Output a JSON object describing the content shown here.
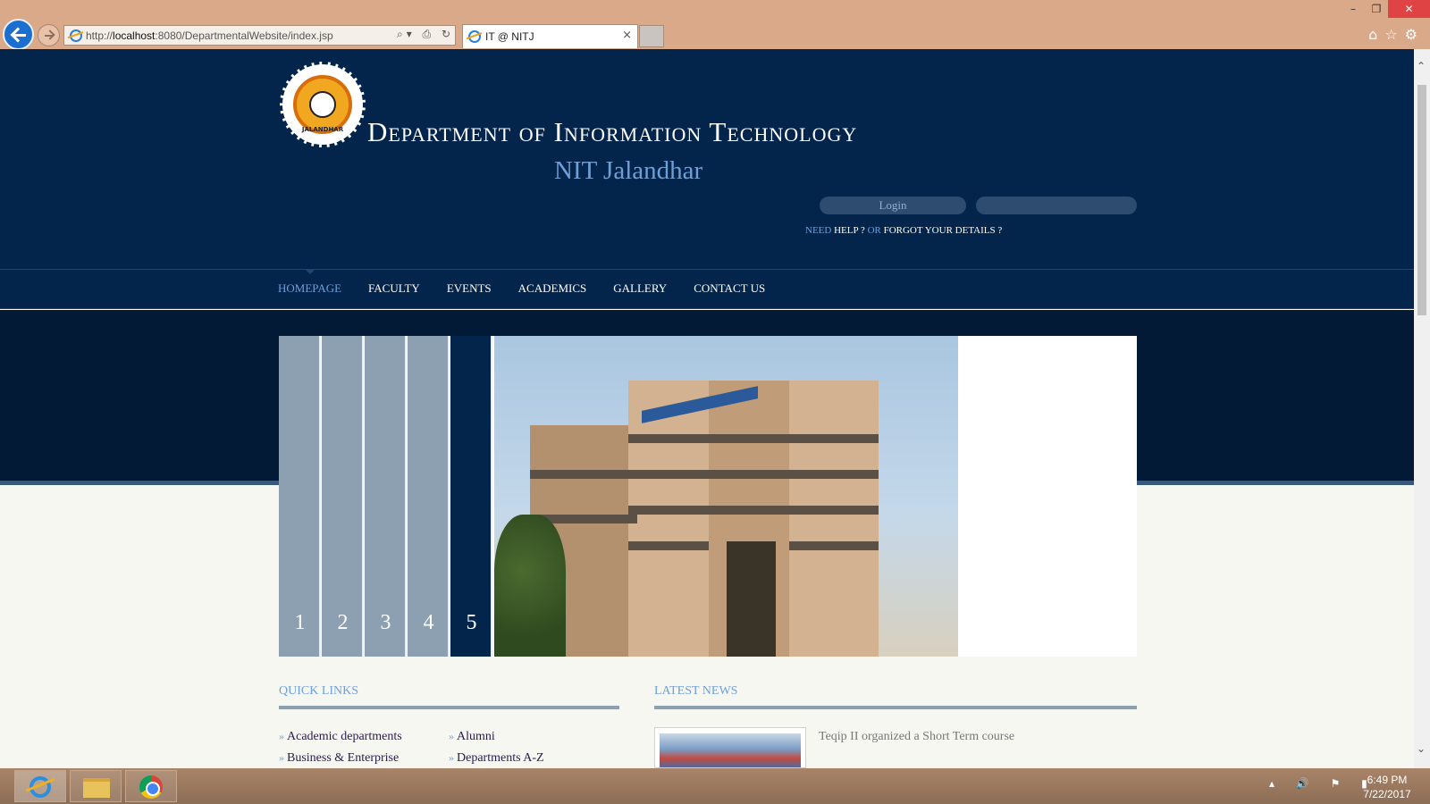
{
  "browser": {
    "url_prefix": "http://",
    "url_host": "localhost",
    "url_rest": ":8080/DepartmentalWebsite/index.jsp",
    "tab_title": "IT @ NITJ",
    "tab_close": "×",
    "addr_tools": "⌕▾ ⎙ ↻",
    "win_minimize": "–",
    "win_restore": "❐",
    "win_close": "✕",
    "right_icons": "⌂☆⚙"
  },
  "header": {
    "logo_text": "JALANDHAR",
    "title": "Department of Information Technology",
    "subtitle": "NIT Jalandhar",
    "login_placeholder": "Login",
    "help_need": "NEED ",
    "help_link": "HELP ?",
    "help_or": " OR ",
    "help_forgot": "FORGOT YOUR DETAILS ?"
  },
  "nav": {
    "items": [
      "HOMEPAGE",
      "FACULTY",
      "EVENTS",
      "ACADEMICS",
      "GALLERY",
      "CONTACT US"
    ],
    "active_index": 0
  },
  "slider": {
    "tabs": [
      "1",
      "2",
      "3",
      "4",
      "5"
    ],
    "active_index": 4
  },
  "quick_links": {
    "title": "QUICK LINKS",
    "items": [
      "Academic departments",
      "Alumni",
      "Business & Enterprise",
      "Departments A-Z"
    ]
  },
  "news": {
    "title": "LATEST NEWS",
    "headline": "Teqip II organized a Short Term course"
  },
  "taskbar": {
    "tray": "▴ 🔊 ⚑ ▮",
    "time": "6:49 PM",
    "date": "7/22/2017"
  },
  "colors": {
    "header_bg": "#03254c",
    "accent": "#6f9fd7",
    "slider_tab": "#8da0b2"
  }
}
